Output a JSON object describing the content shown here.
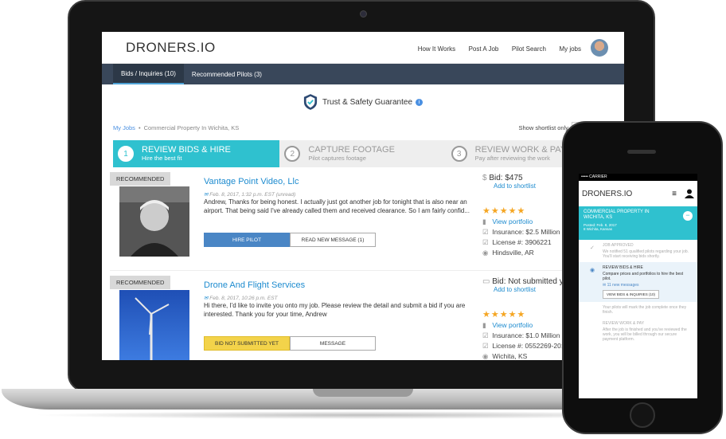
{
  "app": {
    "logo": "DRONERS.IO"
  },
  "nav": {
    "items": [
      "How It Works",
      "Post A Job",
      "Pilot Search",
      "My jobs"
    ]
  },
  "tabs": [
    {
      "label": "Bids / Inquiries (10)"
    },
    {
      "label": "Recommended Pilots (3)"
    }
  ],
  "trust": {
    "label": "Trust & Safety Guarantee"
  },
  "breadcrumb": {
    "root": "My Jobs",
    "sep": "•",
    "current": "Commercial Property In Wichita, KS"
  },
  "shortlist": {
    "label": "Show shortlist only",
    "state": "OFF"
  },
  "steps": [
    {
      "num": "1",
      "title": "REVIEW BIDS & HIRE",
      "sub": "Hire the best fit"
    },
    {
      "num": "2",
      "title": "CAPTURE FOOTAGE",
      "sub": "Pilot captures footage"
    },
    {
      "num": "3",
      "title": "REVIEW WORK & PAY",
      "sub": "Pay after reviewing the work"
    }
  ],
  "pilots": [
    {
      "badge": "RECOMMENDED",
      "name": "Vantage Point Video, Llc",
      "meta": "Feb. 8, 2017, 1:32 p.m. EST (unread)",
      "message": "Andrew, Thanks for being honest. I actually just got another job for tonight that is also near an airport. That being said I've already called them and received clearance. So I am fairly confid...",
      "btn1": "HIRE PILOT",
      "btn2": "READ NEW MESSAGE (1)",
      "bid": "Bid: $475",
      "shortlist": "Add to shortlist",
      "portfolio": "View portfolio",
      "insurance": "Insurance: $2.5 Million",
      "license": "License #: 3906221",
      "location": "Hindsville, AR"
    },
    {
      "badge": "RECOMMENDED",
      "name": "Drone And Flight Services",
      "meta": "Feb. 8, 2017, 10:26 p.m. EST",
      "message": "Hi there, I'd like to invite you onto my job. Please review the detail and submit a bid if you are interested. Thank you for your time, Andrew",
      "btn1": "BID NOT SUBMITTED YET",
      "btn2": "MESSAGE",
      "bid": "Bid: Not submitted y",
      "shortlist": "Add to shortlist",
      "portfolio": "View portfolio",
      "insurance": "Insurance: $1.0 Million",
      "license": "License #: 0552269-2016",
      "location": "Wichita, KS"
    }
  ],
  "colors": {
    "accent": "#2fc1cf",
    "navbar": "#39475a",
    "link": "#1d8bcf",
    "star": "#f5a623",
    "hire": "#4a86c5",
    "pending": "#f3d34a"
  },
  "phone": {
    "carrier": "CARRIER",
    "logo": "DRONERS.IO",
    "job_title": "COMMERCIAL PROPERTY IN WICHITA, KS",
    "job_meta": "Posted: Feb. 8, 2017\n8 Wichita, Kansas",
    "steps": [
      {
        "title": "JOB APPROVED",
        "text": "We notified 51 qualified pilots regarding your job. You'll start receiving bids shortly."
      },
      {
        "title": "REVIEW BIDS & HIRE",
        "text": "Compare prices and portfolios to hire the best pilot.",
        "note": "11 new messages",
        "button": "VIEW BIDS & INQUIRIES (10)"
      },
      {
        "title": "",
        "text": "Your pilots will mark the job complete once they finish."
      },
      {
        "title": "REVIEW WORK & PAY",
        "text": "After the job is finished and you've reviewed the work, you will be billed through our secure payment platform."
      }
    ]
  }
}
